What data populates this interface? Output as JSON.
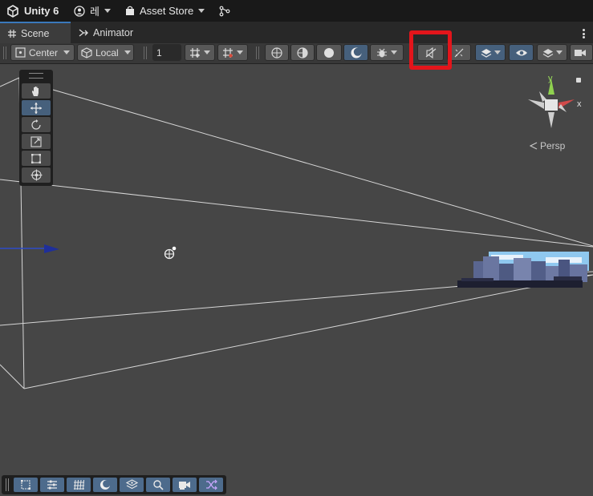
{
  "titlebar": {
    "app_title": "Unity 6",
    "account_label": "레",
    "asset_store_label": "Asset Store"
  },
  "tabs": [
    {
      "label": "Scene",
      "active": true
    },
    {
      "label": "Animator",
      "active": false
    }
  ],
  "toolbar": {
    "pivot_mode": "Center",
    "pivot_rotation": "Local",
    "grid_snap_value": "1"
  },
  "gizmo": {
    "y_label": "y",
    "x_label": "x",
    "persp_label": "Persp"
  },
  "colors": {
    "highlight": "#e3151b",
    "active_blue": "#46607c",
    "background": "#464646"
  },
  "icons": {
    "tools": [
      "hand-icon",
      "move-icon",
      "rotate-icon",
      "scale-icon",
      "rect-icon",
      "transform-icon"
    ],
    "bottom": [
      "rect-select-icon",
      "sliders-icon",
      "grid-icon",
      "moon-icon",
      "layers-icon",
      "search-icon",
      "camera-icon",
      "shuffle-icon"
    ]
  }
}
